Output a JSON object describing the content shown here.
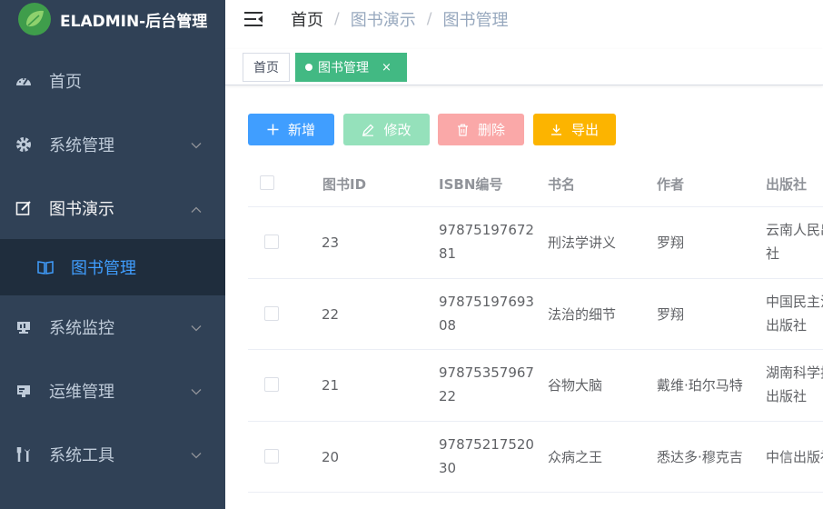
{
  "app": {
    "title": "ELADMIN-后台管理"
  },
  "sidebar": {
    "items": [
      {
        "label": "首页",
        "icon": "dashboard-icon"
      },
      {
        "label": "系统管理",
        "icon": "gear-icon",
        "arrow": "chevron-down"
      },
      {
        "label": "图书演示",
        "icon": "edit-icon",
        "arrow": "chevron-up"
      },
      {
        "label": "系统监控",
        "icon": "monitor-icon",
        "arrow": "chevron-down"
      },
      {
        "label": "运维管理",
        "icon": "server-icon",
        "arrow": "chevron-down"
      },
      {
        "label": "系统工具",
        "icon": "tools-icon",
        "arrow": "chevron-down"
      }
    ],
    "submenu": {
      "label": "图书管理",
      "icon": "book-icon"
    }
  },
  "breadcrumb": [
    "首页",
    "图书演示",
    "图书管理"
  ],
  "tags": [
    {
      "label": "首页",
      "active": false
    },
    {
      "label": "图书管理",
      "active": true,
      "close": "×"
    }
  ],
  "toolbar": {
    "add_label": "新增",
    "edit_label": "修改",
    "delete_label": "删除",
    "export_label": "导出"
  },
  "table": {
    "headers": [
      "图书ID",
      "ISBN编号",
      "书名",
      "作者",
      "出版社"
    ],
    "rows": [
      {
        "id": "23",
        "isbn": [
          "97875197672",
          "81"
        ],
        "title": "刑法学讲义",
        "author": "罗翔",
        "publisher": [
          "云南人民出",
          "社"
        ]
      },
      {
        "id": "22",
        "isbn": [
          "97875197693",
          "08"
        ],
        "title": "法治的细节",
        "author": "罗翔",
        "publisher": [
          "中国民主法",
          "出版社"
        ]
      },
      {
        "id": "21",
        "isbn": [
          "97875357967",
          "22"
        ],
        "title": "谷物大脑",
        "author": "戴维·珀尔马特",
        "publisher": [
          "湖南科学技",
          "出版社"
        ]
      },
      {
        "id": "20",
        "isbn": [
          "97875217520",
          "30"
        ],
        "title": "众病之王",
        "author": "悉达多·穆克吉",
        "publisher": [
          "中信出版社",
          ""
        ]
      }
    ]
  },
  "colors": {
    "sidebar_bg": "#304156",
    "submenu_bg": "#1f2d3d",
    "accent": "#409eff",
    "tag_active": "#42b983",
    "btn_edit": "#95e1bb",
    "btn_delete": "#faa8a8",
    "btn_export": "#fcb400"
  }
}
